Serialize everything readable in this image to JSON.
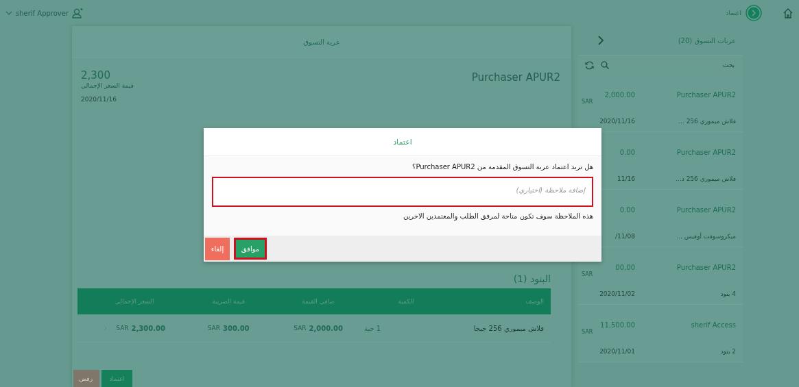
{
  "top_bar": {
    "user": "sherif Approver",
    "page_label": "اعتماد"
  },
  "cart": {
    "title": "عربة التسوق",
    "total": "2,300",
    "total_label": "قيمة السعر الإجمالي",
    "date": "2020/11/16",
    "requester": "Purchaser APUR2",
    "items_heading": "البنود (1)",
    "columns": [
      "الوصف",
      "الكمية",
      "صافي القيمة",
      "قيمة الضريبة",
      "السعر الإجمالي"
    ],
    "rows": [
      {
        "description": "فلاش ميموري 256 جيجا",
        "quantity": "1 حبة",
        "net": {
          "currency": "SAR",
          "value": "2,000.00"
        },
        "tax": {
          "currency": "SAR",
          "value": "300.00"
        },
        "total": {
          "currency": "SAR",
          "value": "2,300.00"
        }
      }
    ],
    "actions": [
      {
        "label": "اعتماد",
        "kind": "approve"
      },
      {
        "label": "رفض",
        "kind": "reject"
      }
    ]
  },
  "list": {
    "title": "عربات التسوق (20)",
    "search_placeholder": "بحث",
    "items": [
      {
        "name": "Purchaser APUR2",
        "amount": "2,000.00",
        "currency": "SAR",
        "date": "2020/11/16",
        "summary": "فلاش ميموري 256 ..."
      },
      {
        "name": "Purchaser APUR2",
        "amount": "0.00",
        "date": "11/16",
        "summary": "فلاش ميموري 256 د..."
      },
      {
        "name": "Purchaser APUR2",
        "amount": "0.00",
        "date": "/11/08",
        "summary": "ميكروسوفت أوفيس ..."
      },
      {
        "name": "Purchaser APUR2",
        "amount": "00,00",
        "currency": "SAR",
        "date": "2020/11/02",
        "summary": "4 بنود"
      },
      {
        "name": "sherif Access",
        "amount": "11,500.00",
        "currency": "SAR",
        "date": "2020/11/01",
        "summary": "2 بنود"
      }
    ]
  },
  "dialog": {
    "title": "اعتماد",
    "question": "هل تريد اعتماد عربة التسوق المقدمة من Purchaser APUR2؟",
    "placeholder": "إضافة ملاحظة (اختياري)",
    "note": "هذه الملاحظة سوف تكون متاحة لمرفق الطلب والمعتمدين الاخرين",
    "buttons": [
      {
        "label": "موافق",
        "kind": "confirm"
      },
      {
        "label": "إلغاء",
        "kind": "cancel"
      }
    ]
  }
}
